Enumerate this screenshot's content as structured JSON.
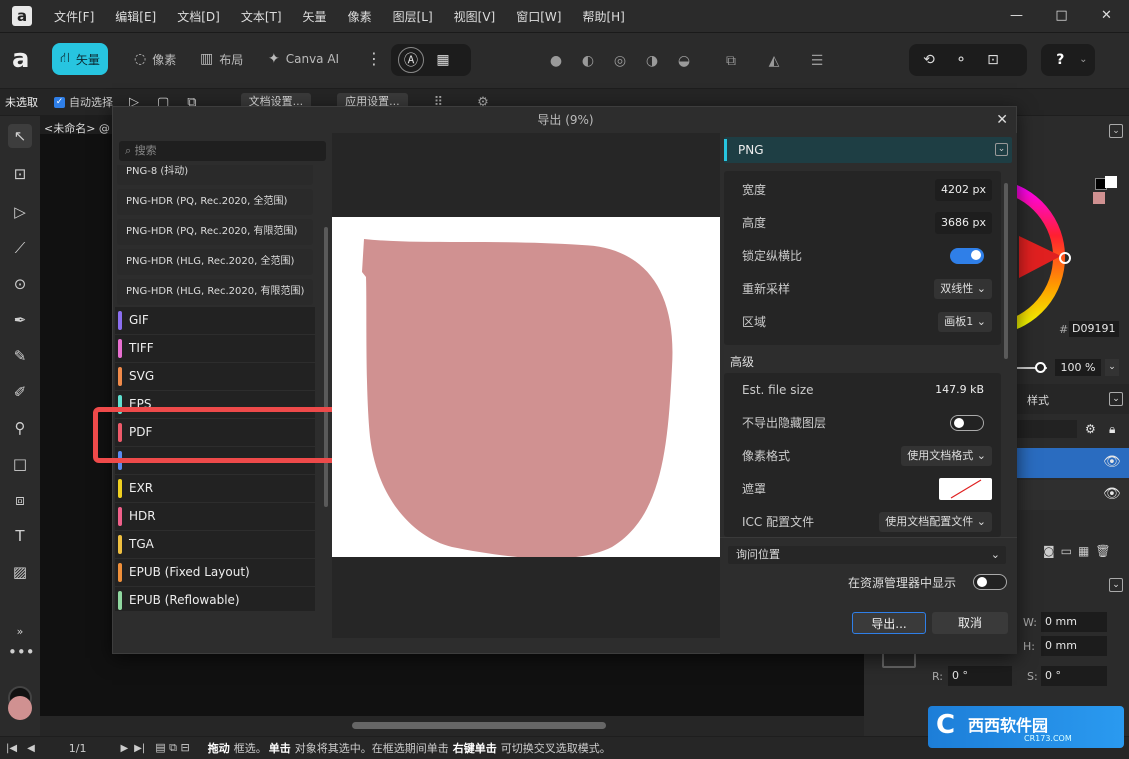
{
  "menubar": {
    "logo": "a",
    "items": [
      "文件[F]",
      "编辑[E]",
      "文档[D]",
      "文本[T]",
      "矢量",
      "像素",
      "图层[L]",
      "视图[V]",
      "窗口[W]",
      "帮助[H]"
    ],
    "win_minimize": "—",
    "win_maximize": "□",
    "win_close": "✕"
  },
  "toolbar": {
    "personas": [
      {
        "label": "矢量",
        "icon": "vector-icon"
      },
      {
        "label": "像素",
        "icon": "pixel-icon"
      },
      {
        "label": "布局",
        "icon": "layout-icon"
      },
      {
        "label": "Canva AI",
        "icon": "sparkle-icon"
      }
    ],
    "more": "⋮"
  },
  "context": {
    "selection": "未选取",
    "auto_select": "自动选择",
    "doc_settings": "文档设置...",
    "app_settings": "应用设置..."
  },
  "document": {
    "tab": "<未命名> @"
  },
  "right_panel": {
    "hex": "D09191",
    "opacity": "100 %",
    "styles_tab": "样式",
    "w_label": "W:",
    "w_value": "0 mm",
    "h_label": "H:",
    "h_value": "0 mm",
    "r_label": "R:",
    "r_value": "0 °",
    "s_label": "S:",
    "s_value": "0 °"
  },
  "statusbar": {
    "page": "1/1",
    "hint_drag": "拖动",
    "hint_1": "框选。",
    "hint_click": "单击",
    "hint_2": "对象将其选中。在框选期间单击",
    "hint_right": "右键单击",
    "hint_3": "可切换交叉选取模式。"
  },
  "watermark": {
    "text": "西西软件园",
    "sub": "CR173.COM"
  },
  "dialog": {
    "title": "导出 (9%)",
    "close": "✕",
    "search_placeholder": "搜索",
    "sub_formats": [
      "PNG-8 (抖动)",
      "PNG-HDR (PQ, Rec.2020, 全范围)",
      "PNG-HDR (PQ, Rec.2020, 有限范围)",
      "PNG-HDR (HLG, Rec.2020, 全范围)",
      "PNG-HDR (HLG, Rec.2020, 有限范围)"
    ],
    "formats": [
      {
        "label": "GIF",
        "color": "#8b6ef0"
      },
      {
        "label": "TIFF",
        "color": "#e86fd0"
      },
      {
        "label": "SVG",
        "color": "#f08a4a"
      },
      {
        "label": "EPS",
        "color": "#5fe0d0"
      },
      {
        "label": "PDF",
        "color": "#ee5a6a"
      },
      {
        "label": "",
        "color": "#5a8af0"
      },
      {
        "label": "EXR",
        "color": "#f0d020"
      },
      {
        "label": "HDR",
        "color": "#f0608a"
      },
      {
        "label": "TGA",
        "color": "#f0c040"
      },
      {
        "label": "EPUB (Fixed Layout)",
        "color": "#f0903a"
      },
      {
        "label": "EPUB (Reflowable)",
        "color": "#90d8a0"
      }
    ],
    "format_header": "PNG",
    "settings": {
      "width_label": "宽度",
      "width_value": "4202 px",
      "height_label": "高度",
      "height_value": "3686 px",
      "lock_label": "锁定纵横比",
      "resample_label": "重新采样",
      "resample_value": "双线性",
      "area_label": "区域",
      "area_value": "画板1",
      "advanced": "高级",
      "filesize_label": "Est. file size",
      "filesize_value": "147.9 kB",
      "hidden_label": "不导出隐藏图层",
      "pixfmt_label": "像素格式",
      "pixfmt_value": "使用文档格式",
      "matte_label": "遮罩",
      "icc_label": "ICC 配置文件",
      "icc_value": "使用文档配置文件"
    },
    "location": "询问位置",
    "show_in_explorer": "在资源管理器中显示",
    "export_button": "导出...",
    "cancel_button": "取消"
  },
  "colors": {
    "accent": "#27c5e0",
    "shape_fill": "#d09191",
    "highlight": "#ee4a4a"
  }
}
